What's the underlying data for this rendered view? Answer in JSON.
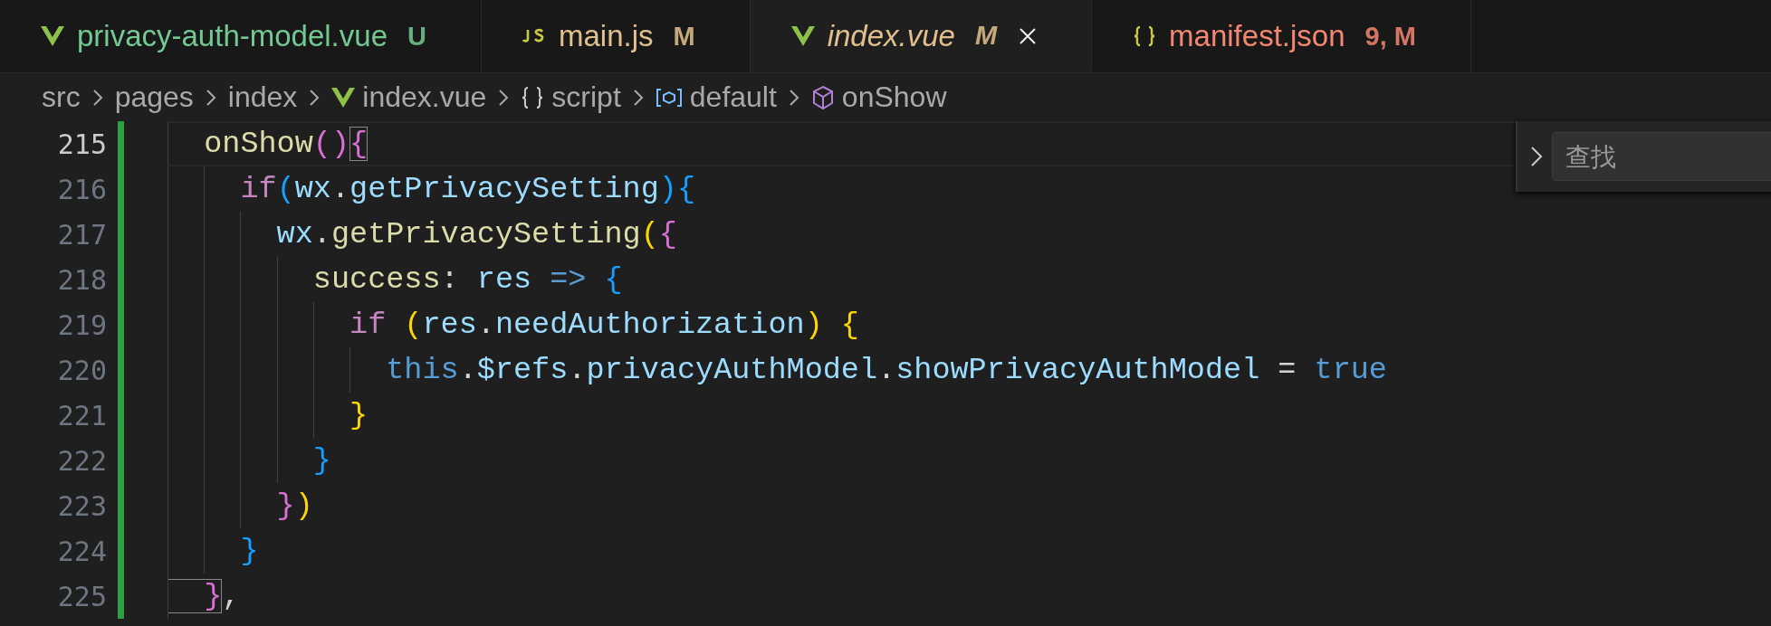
{
  "tabs": [
    {
      "kind": "vue",
      "label": "privacy-auth-model.vue",
      "badge": "U",
      "color": "#73c991",
      "selected": false,
      "italic": false
    },
    {
      "kind": "js",
      "label": "main.js",
      "badge": "M",
      "color": "#e2c08d",
      "selected": false,
      "italic": false
    },
    {
      "kind": "vue",
      "label": "index.vue",
      "badge": "M",
      "color": "#e2c08d",
      "selected": true,
      "italic": true
    },
    {
      "kind": "json",
      "label": "manifest.json",
      "badge": "9, M",
      "color": "#f48771",
      "selected": false,
      "italic": false
    }
  ],
  "breadcrumbs": [
    {
      "label": "src",
      "kind": "folder"
    },
    {
      "label": "pages",
      "kind": "folder"
    },
    {
      "label": "index",
      "kind": "folder"
    },
    {
      "label": "index.vue",
      "kind": "vue"
    },
    {
      "label": "script",
      "kind": "braces"
    },
    {
      "label": "default",
      "kind": "module"
    },
    {
      "label": "onShow",
      "kind": "method"
    }
  ],
  "find_widget": {
    "placeholder": "查找"
  },
  "editor": {
    "lines": [
      {
        "number": "215",
        "current": true,
        "added": true,
        "tokens": [
          {
            "text": "  onShow",
            "kind": "function"
          },
          {
            "text": "()",
            "kind": "bracket",
            "color": "#da70d6"
          },
          {
            "text": "{",
            "kind": "bracket",
            "color": "#da70d6",
            "match": true
          }
        ]
      },
      {
        "number": "216",
        "current": false,
        "added": true,
        "tokens": [
          {
            "text": "    if",
            "kind": "keyword"
          },
          {
            "text": "(",
            "kind": "bracket",
            "color": "#179fff"
          },
          {
            "text": "wx",
            "kind": "variable"
          },
          {
            "text": ".",
            "kind": "plain"
          },
          {
            "text": "getPrivacySetting",
            "kind": "variable"
          },
          {
            "text": "){",
            "kind": "bracket",
            "color": "#179fff"
          }
        ]
      },
      {
        "number": "217",
        "current": false,
        "added": true,
        "tokens": [
          {
            "text": "      wx",
            "kind": "variable"
          },
          {
            "text": ".",
            "kind": "plain"
          },
          {
            "text": "getPrivacySetting",
            "kind": "function"
          },
          {
            "text": "(",
            "kind": "bracket",
            "color": "#ffd700"
          },
          {
            "text": "{",
            "kind": "bracket",
            "color": "#da70d6"
          }
        ]
      },
      {
        "number": "218",
        "current": false,
        "added": true,
        "tokens": [
          {
            "text": "        success",
            "kind": "function"
          },
          {
            "text": ": ",
            "kind": "plain"
          },
          {
            "text": "res",
            "kind": "variable"
          },
          {
            "text": " => ",
            "kind": "storage"
          },
          {
            "text": "{",
            "kind": "bracket",
            "color": "#179fff"
          }
        ]
      },
      {
        "number": "219",
        "current": false,
        "added": true,
        "tokens": [
          {
            "text": "          if ",
            "kind": "keyword"
          },
          {
            "text": "(",
            "kind": "bracket",
            "color": "#ffd700"
          },
          {
            "text": "res",
            "kind": "variable"
          },
          {
            "text": ".",
            "kind": "plain"
          },
          {
            "text": "needAuthorization",
            "kind": "variable"
          },
          {
            "text": ") {",
            "kind": "bracket",
            "color": "#ffd700"
          }
        ]
      },
      {
        "number": "220",
        "current": false,
        "added": true,
        "tokens": [
          {
            "text": "            this",
            "kind": "storage"
          },
          {
            "text": ".",
            "kind": "plain"
          },
          {
            "text": "$refs",
            "kind": "variable"
          },
          {
            "text": ".",
            "kind": "plain"
          },
          {
            "text": "privacyAuthModel",
            "kind": "variable"
          },
          {
            "text": ".",
            "kind": "plain"
          },
          {
            "text": "showPrivacyAuthModel",
            "kind": "variable"
          },
          {
            "text": " = ",
            "kind": "plain"
          },
          {
            "text": "true",
            "kind": "storage"
          }
        ]
      },
      {
        "number": "221",
        "current": false,
        "added": true,
        "tokens": [
          {
            "text": "          }",
            "kind": "bracket",
            "color": "#ffd700"
          }
        ]
      },
      {
        "number": "222",
        "current": false,
        "added": true,
        "tokens": [
          {
            "text": "        }",
            "kind": "bracket",
            "color": "#179fff"
          }
        ]
      },
      {
        "number": "223",
        "current": false,
        "added": true,
        "tokens": [
          {
            "text": "      }",
            "kind": "bracket",
            "color": "#da70d6"
          },
          {
            "text": ")",
            "kind": "bracket",
            "color": "#ffd700"
          }
        ]
      },
      {
        "number": "224",
        "current": false,
        "added": true,
        "tokens": [
          {
            "text": "    }",
            "kind": "bracket",
            "color": "#179fff"
          }
        ]
      },
      {
        "number": "225",
        "current": false,
        "added": true,
        "tokens": [
          {
            "text": "  }",
            "kind": "bracket",
            "color": "#da70d6",
            "match": true
          },
          {
            "text": ",",
            "kind": "plain"
          }
        ]
      }
    ]
  }
}
